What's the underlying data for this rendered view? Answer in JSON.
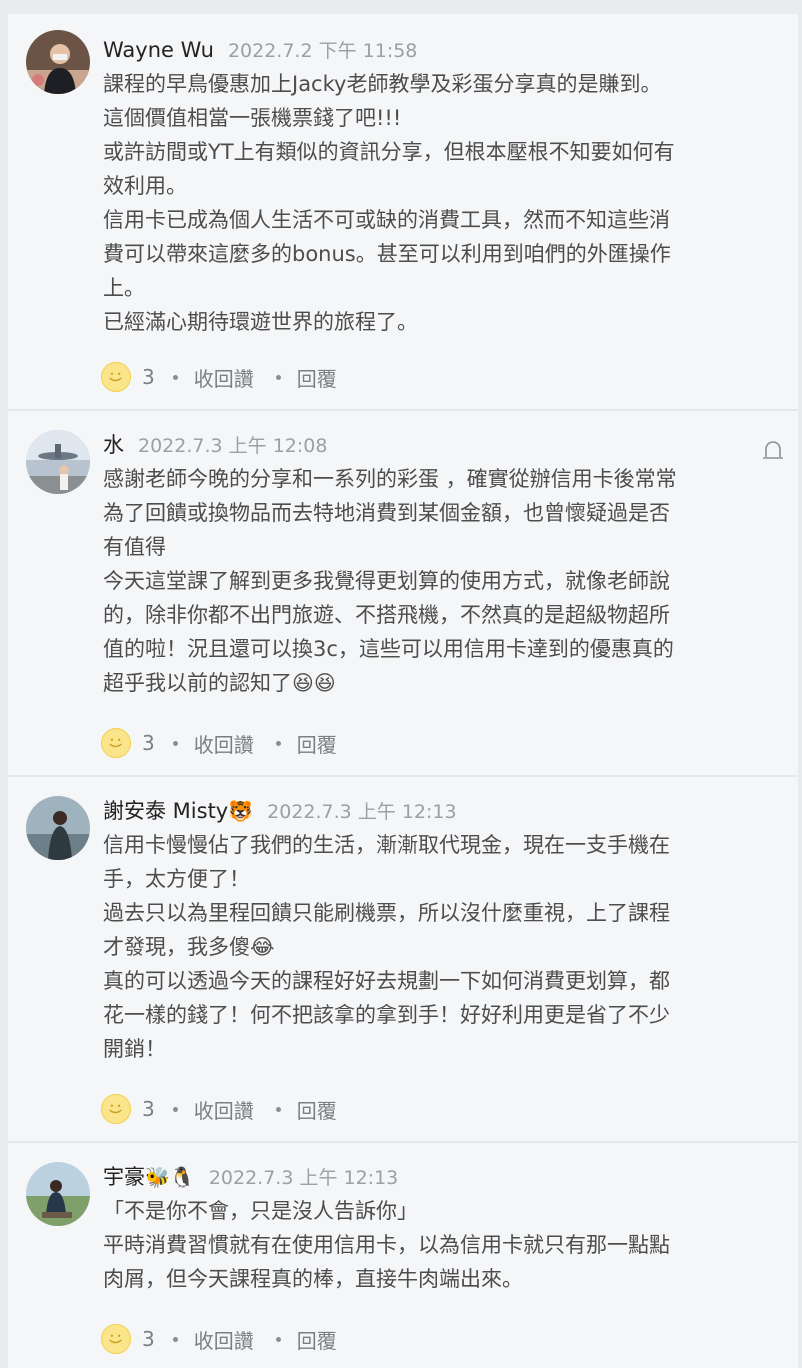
{
  "comments": [
    {
      "author": "Wayne Wu",
      "author_emoji": "",
      "time": "2022.7.2 下午 11:58",
      "paragraphs": [
        "課程的早鳥優惠加上Jacky老師教學及彩蛋分享真的是賺到。",
        "這個價值相當一張機票錢了吧!!!",
        "或許訪間或YT上有類似的資訊分享，但根本壓根不知要如何有",
        "效利用。",
        "信用卡已成為個人生活不可或缺的消費工具，然而不知這些消",
        "費可以帶來這麼多的bonus。甚至可以利用到咱們的外匯操作",
        "上。",
        "已經滿心期待環遊世界的旅程了。"
      ],
      "reaction_count": "3",
      "unlike_label": "收回讚",
      "reply_label": "回覆"
    },
    {
      "author": "水",
      "author_emoji": "",
      "time": "2022.7.3 上午 12:08",
      "paragraphs": [
        "感謝老師今晚的分享和一系列的彩蛋 ，確實從辦信用卡後常常",
        "為了回饋或換物品而去特地消費到某個金額，也曾懷疑過是否",
        "有值得",
        "今天這堂課了解到更多我覺得更划算的使用方式，就像老師說",
        "的，除非你都不出門旅遊、不搭飛機，不然真的是超級物超所",
        "值的啦！況且還可以換3c，這些可以用信用卡達到的優惠真的",
        "超乎我以前的認知了😆😆"
      ],
      "reaction_count": "3",
      "unlike_label": "收回讚",
      "reply_label": "回覆"
    },
    {
      "author": "謝安泰 Misty",
      "author_emoji": "🐯",
      "time": "2022.7.3 上午 12:13",
      "paragraphs": [
        "信用卡慢慢佔了我們的生活，漸漸取代現金，現在一支手機在",
        "手，太方便了！",
        "過去只以為里程回饋只能刷機票，所以沒什麼重視，上了課程",
        "才發現，我多傻😂",
        "真的可以透過今天的課程好好去規劃一下如何消費更划算，都",
        "花一樣的錢了！何不把該拿的拿到手！好好利用更是省了不少",
        "開銷！"
      ],
      "reaction_count": "3",
      "unlike_label": "收回讚",
      "reply_label": "回覆"
    },
    {
      "author": "宇豪",
      "author_emoji": "🐝🐧",
      "time": "2022.7.3 上午 12:13",
      "paragraphs": [
        "「不是你不會，只是沒人告訴你」",
        "平時消費習慣就有在使用信用卡，以為信用卡就只有那一點點",
        "肉屑，但今天課程真的棒，直接牛肉端出來。"
      ],
      "reaction_count": "3",
      "unlike_label": "收回讚",
      "reply_label": "回覆"
    }
  ],
  "icons": {
    "reaction": "smiley-face-icon",
    "report": "report-bell-icon"
  },
  "colors": {
    "background": "#f5f6f8",
    "author": "#222222",
    "timestamp": "#9aa0a6",
    "body": "#4d4d4d",
    "action": "#7a7f85",
    "reaction_fill": "#fbe58a"
  }
}
